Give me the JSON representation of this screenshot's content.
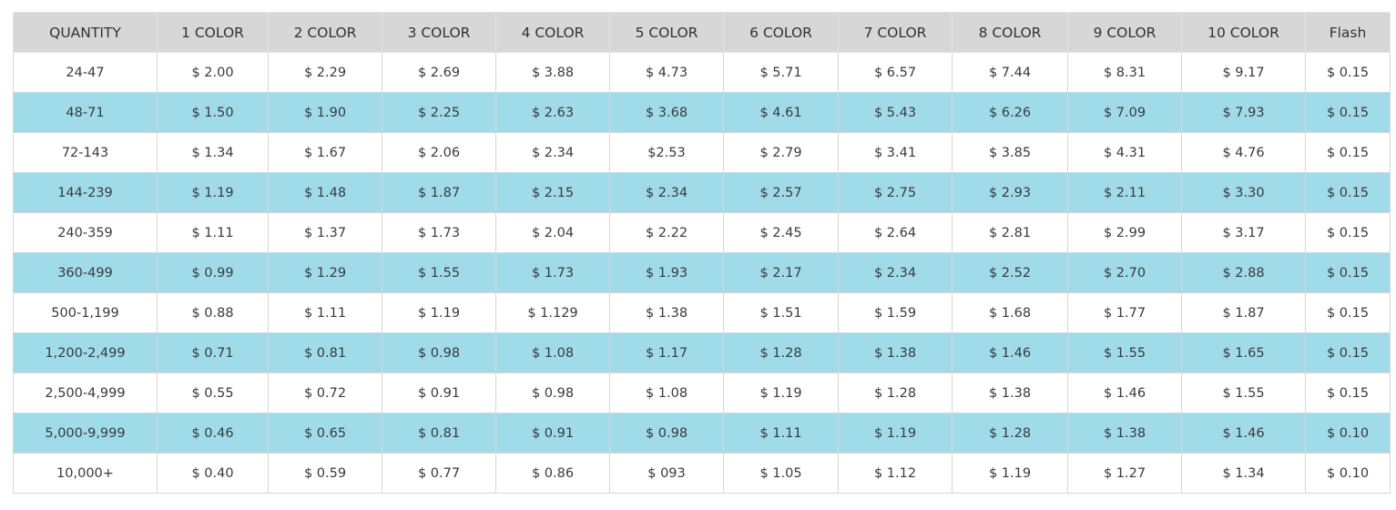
{
  "table": {
    "headers": [
      "QUANTITY",
      "1 COLOR",
      "2 COLOR",
      "3 COLOR",
      "4 COLOR",
      "5 COLOR",
      "6 COLOR",
      "7 COLOR",
      "8 COLOR",
      "9 COLOR",
      "10 COLOR",
      "Flash"
    ],
    "rows": [
      [
        "24-47",
        "$ 2.00",
        "$ 2.29",
        "$ 2.69",
        "$ 3.88",
        "$ 4.73",
        "$ 5.71",
        "$ 6.57",
        "$ 7.44",
        "$ 8.31",
        "$ 9.17",
        "$ 0.15"
      ],
      [
        "48-71",
        "$ 1.50",
        "$ 1.90",
        "$ 2.25",
        "$ 2.63",
        "$ 3.68",
        "$ 4.61",
        "$ 5.43",
        "$ 6.26",
        "$ 7.09",
        "$ 7.93",
        "$ 0.15"
      ],
      [
        "72-143",
        "$ 1.34",
        "$ 1.67",
        "$ 2.06",
        "$ 2.34",
        "$2.53",
        "$ 2.79",
        "$ 3.41",
        "$ 3.85",
        "$ 4.31",
        "$ 4.76",
        "$ 0.15"
      ],
      [
        "144-239",
        "$ 1.19",
        "$ 1.48",
        "$ 1.87",
        "$ 2.15",
        "$ 2.34",
        "$ 2.57",
        "$ 2.75",
        "$ 2.93",
        "$ 2.11",
        "$ 3.30",
        "$ 0.15"
      ],
      [
        "240-359",
        "$ 1.11",
        "$ 1.37",
        "$ 1.73",
        "$ 2.04",
        "$ 2.22",
        "$ 2.45",
        "$ 2.64",
        "$ 2.81",
        "$ 2.99",
        "$ 3.17",
        "$ 0.15"
      ],
      [
        "360-499",
        "$ 0.99",
        "$ 1.29",
        "$ 1.55",
        "$ 1.73",
        "$ 1.93",
        "$ 2.17",
        "$ 2.34",
        "$ 2.52",
        "$ 2.70",
        "$ 2.88",
        "$ 0.15"
      ],
      [
        "500-1,199",
        "$ 0.88",
        "$ 1.11",
        "$ 1.19",
        "$ 1.129",
        "$ 1.38",
        "$ 1.51",
        "$ 1.59",
        "$ 1.68",
        "$ 1.77",
        "$ 1.87",
        "$ 0.15"
      ],
      [
        "1,200-2,499",
        "$ 0.71",
        "$ 0.81",
        "$ 0.98",
        "$ 1.08",
        "$ 1.17",
        "$ 1.28",
        "$ 1.38",
        "$ 1.46",
        "$ 1.55",
        "$ 1.65",
        "$ 0.15"
      ],
      [
        "2,500-4,999",
        "$ 0.55",
        "$ 0.72",
        "$ 0.91",
        "$ 0.98",
        "$ 1.08",
        "$ 1.19",
        "$ 1.28",
        "$ 1.38",
        "$ 1.46",
        "$ 1.55",
        "$ 0.15"
      ],
      [
        "5,000-9,999",
        "$ 0.46",
        "$ 0.65",
        "$ 0.81",
        "$ 0.91",
        "$ 0.98",
        "$ 1.11",
        "$ 1.19",
        "$ 1.28",
        "$ 1.38",
        "$ 1.46",
        "$ 0.10"
      ],
      [
        "10,000+",
        "$ 0.40",
        "$ 0.59",
        "$ 0.77",
        "$ 0.86",
        "$ 093",
        "$ 1.05",
        "$ 1.12",
        "$ 1.19",
        "$ 1.27",
        "$ 1.34",
        "$ 0.10"
      ]
    ]
  },
  "colors": {
    "header_bg": "#d7d7d7",
    "alt_row_bg": "#a0dbea",
    "row_bg": "#ffffff",
    "border": "#d6d6d6"
  }
}
